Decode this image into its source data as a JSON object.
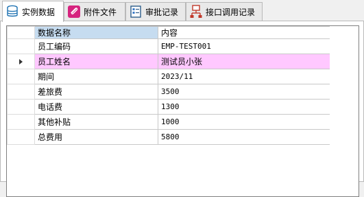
{
  "tabs": [
    {
      "label": "实例数据",
      "icon": "database-icon",
      "active": true
    },
    {
      "label": "附件文件",
      "icon": "paperclip-icon",
      "active": false
    },
    {
      "label": "审批记录",
      "icon": "checklist-icon",
      "active": false
    },
    {
      "label": "接口调用记录",
      "icon": "network-icon",
      "active": false
    }
  ],
  "grid": {
    "headers": {
      "name": "数据名称",
      "value": "内容"
    },
    "rows": [
      {
        "name": "员工编码",
        "value": "EMP-TEST001"
      },
      {
        "name": "员工姓名",
        "value": "测试员小张"
      },
      {
        "name": "期间",
        "value": "2023/11"
      },
      {
        "name": "差旅费",
        "value": "3500"
      },
      {
        "name": "电话费",
        "value": "1300"
      },
      {
        "name": "其他补贴",
        "value": "1000"
      },
      {
        "name": "总费用",
        "value": "5800"
      }
    ],
    "selected_row": 1
  },
  "colors": {
    "selected_row": "#ffc8ff",
    "header_name_col": "#c6dcf0"
  }
}
